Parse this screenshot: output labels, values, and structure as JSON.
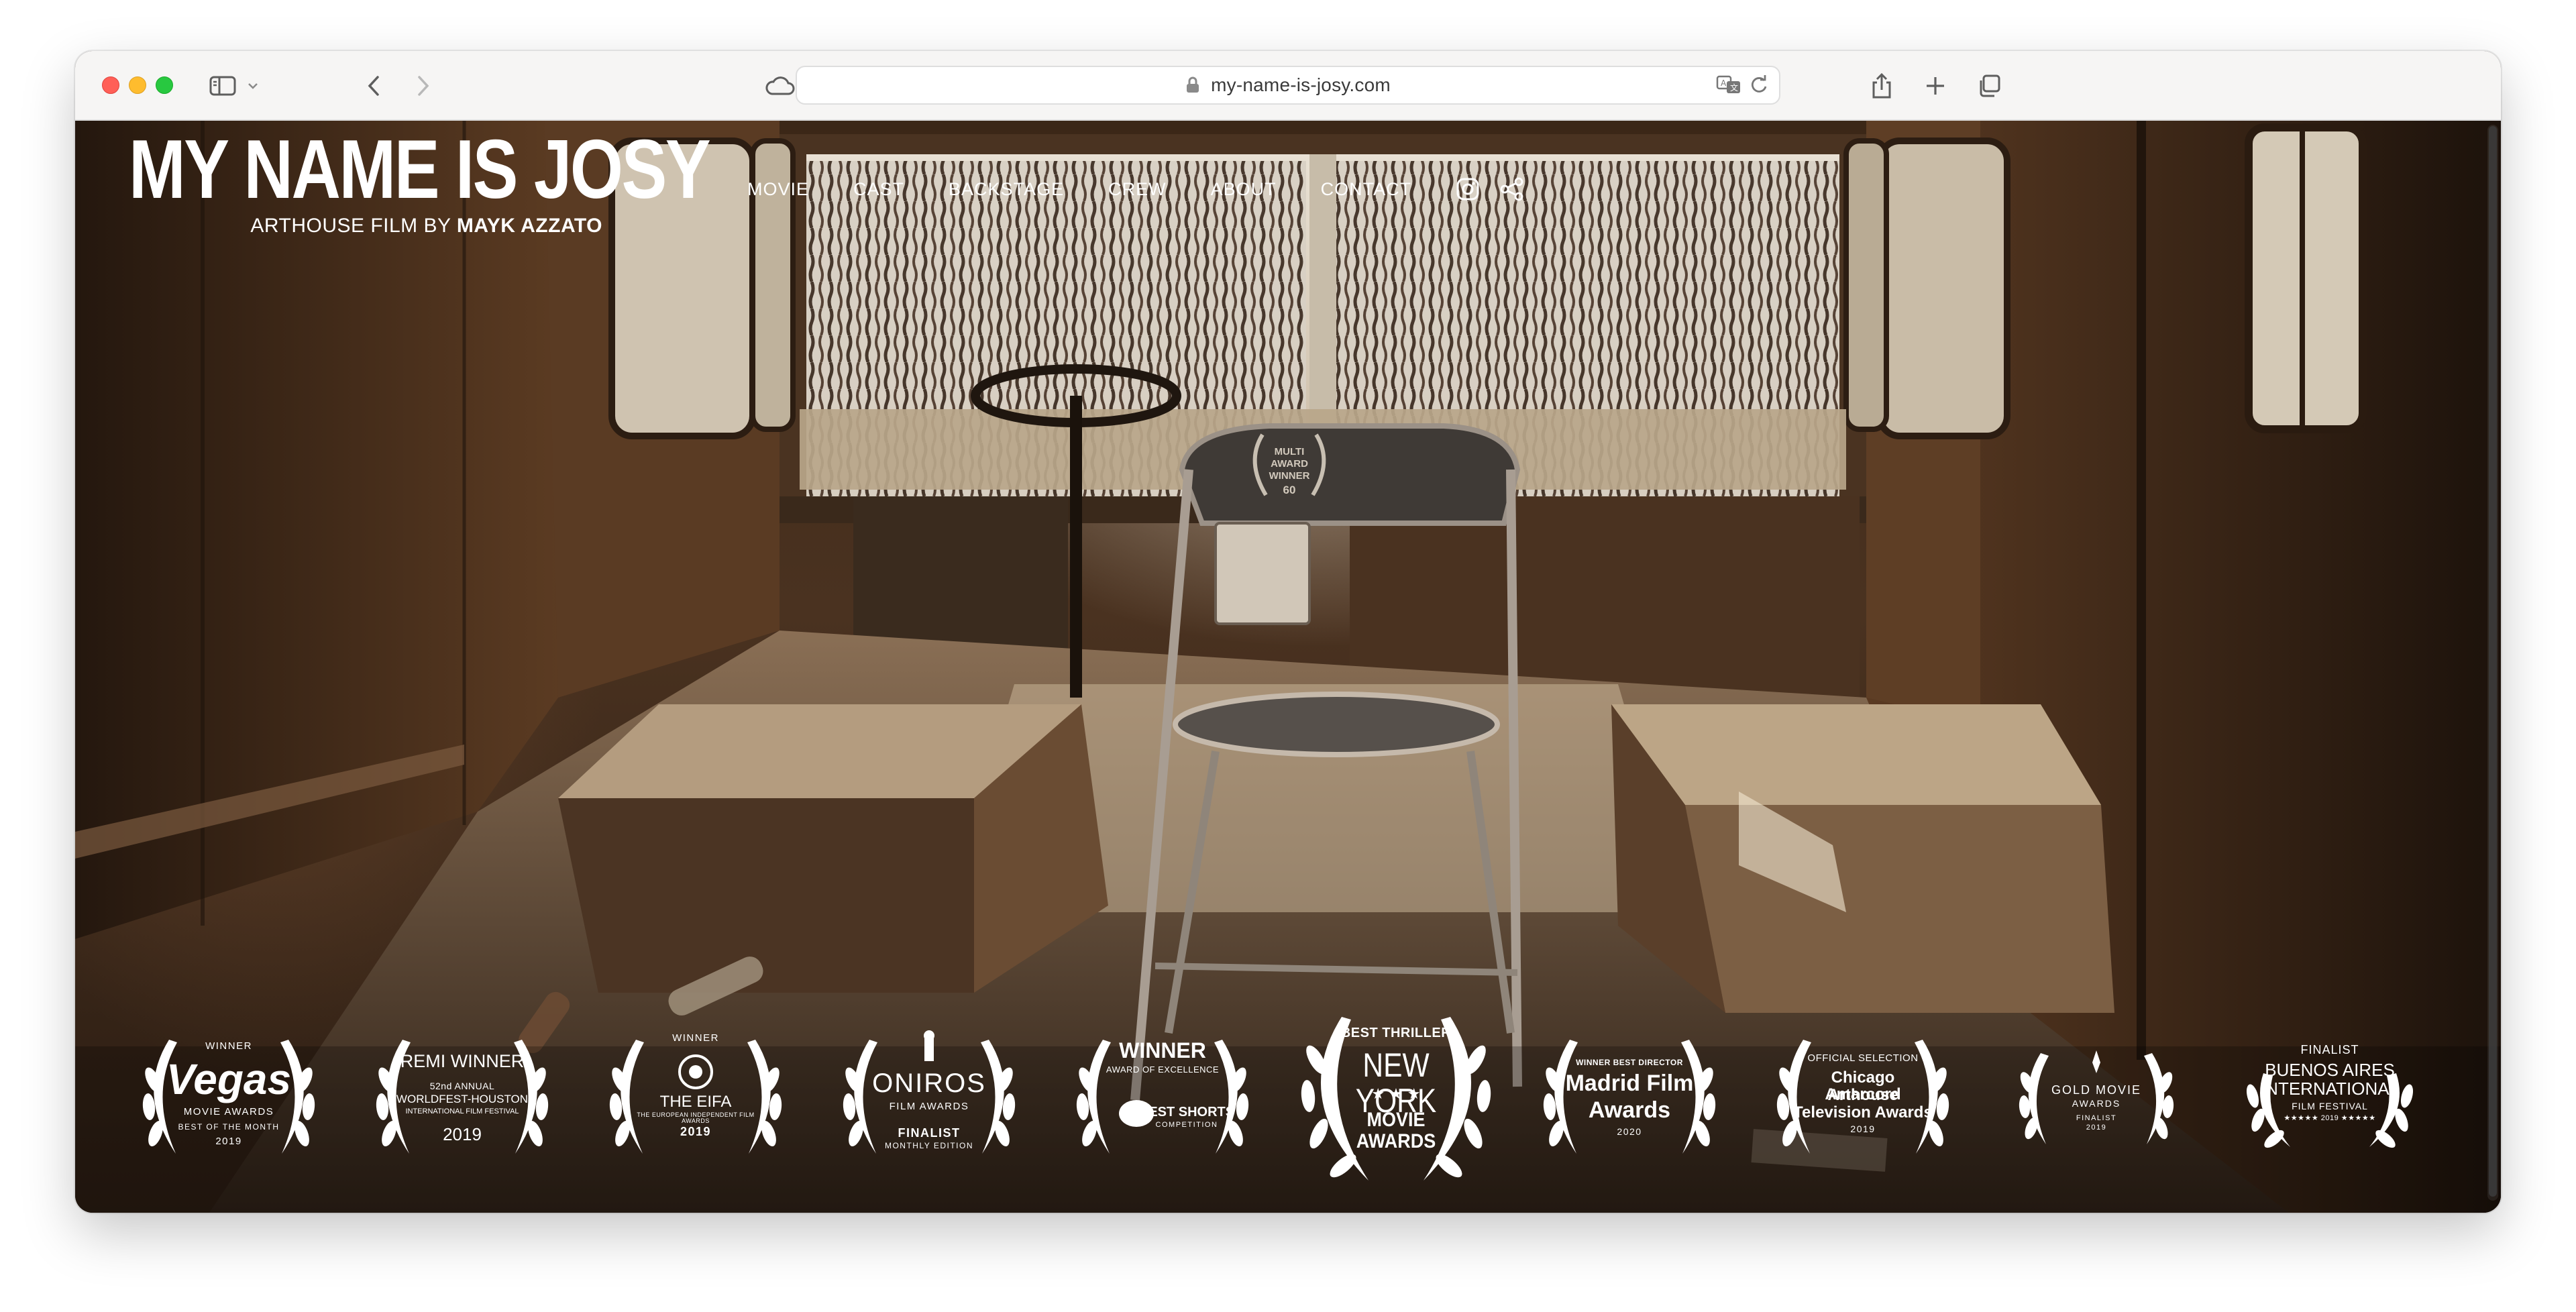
{
  "browser": {
    "url": "my-name-is-josy.com"
  },
  "site": {
    "title": "MY NAME IS JOSY",
    "subtitle_prefix": "ARTHOUSE FILM BY ",
    "subtitle_name": "MAYK AZZATO"
  },
  "nav": {
    "items": [
      "MOVIE",
      "CAST",
      "BACKSTAGE",
      "CREW",
      "ABOUT",
      "CONTACT"
    ],
    "icons": [
      "instagram-icon",
      "share-icon"
    ]
  },
  "hero": {
    "chair_badge": [
      "MULTI",
      "AWARD",
      "WINNER",
      "60"
    ]
  },
  "awards": [
    {
      "top": "WINNER",
      "main": "Vegas",
      "line2": "MOVIE AWARDS",
      "line3": "BEST OF THE MONTH",
      "line4": "2019"
    },
    {
      "top": "REMI WINNER",
      "line2": "52nd ANNUAL",
      "line3": "WORLDFEST-HOUSTON",
      "line4": "INTERNATIONAL FILM FESTIVAL",
      "line5": "2019"
    },
    {
      "top": "WINNER",
      "main": "THE EIFA",
      "line2": "THE EUROPEAN INDEPENDENT FILM AWARDS",
      "line3": "2019"
    },
    {
      "main": "ONIROS",
      "line2": "FILM AWARDS",
      "line3": "FINALIST",
      "line4": "MONTHLY EDITION"
    },
    {
      "top": "WINNER",
      "line2": "AWARD OF EXCELLENCE",
      "main": "BEST SHORTS",
      "line3": "COMPETITION"
    },
    {
      "top": "BEST THRILLER",
      "main": "NEW YORK",
      "line2": "MOVIE AWARDS"
    },
    {
      "top": "WINNER BEST DIRECTOR",
      "main": "Madrid Film",
      "line2": "Awards",
      "line3": "2020"
    },
    {
      "top": "OFFICIAL SELECTION",
      "main": "Chicago Amarcord",
      "line2": "Arthouse",
      "line3": "Television Awards",
      "line4": "2019"
    },
    {
      "main": "GOLD MOVIE",
      "line2": "AWARDS",
      "line3": "FINALIST",
      "line4": "2019"
    },
    {
      "top": "FINALIST",
      "main": "BUENOS AIRES",
      "line2": "INTERNATIONAL",
      "line3": "FILM FESTIVAL",
      "line4": "★★★★★ 2019 ★★★★★"
    }
  ],
  "colors": {
    "accent_text": "#ffffff",
    "scene_dark": "#2a1c12",
    "scene_wood": "#5a3a22"
  }
}
